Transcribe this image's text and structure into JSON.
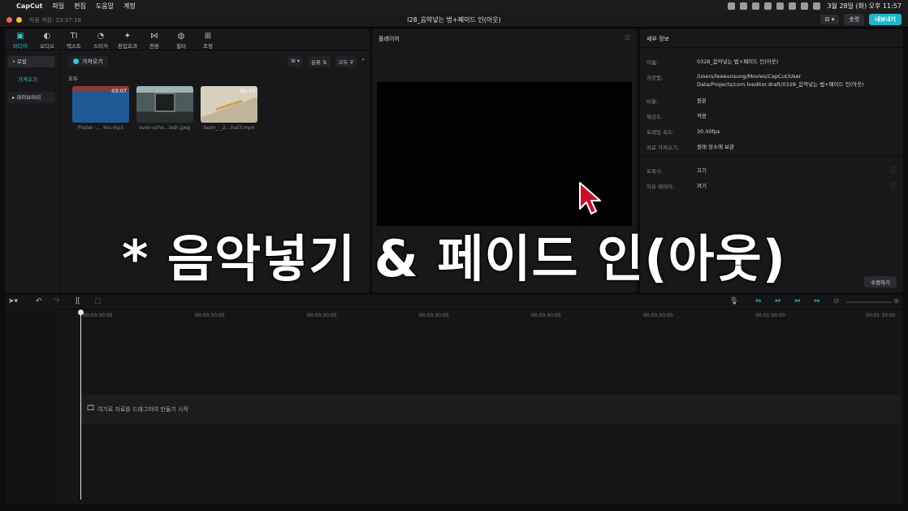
{
  "menubar": {
    "apple": "",
    "app_name": "CapCut",
    "items": [
      "파일",
      "편집",
      "도움말",
      "계정"
    ],
    "clock": "3월 28일 (화) 오후 11:57"
  },
  "titlebar": {
    "autosave": "자동 저장: 23:57:18",
    "title": "l28_음악넣는 법+페이드 인(아웃)",
    "shortcut_label": "숏컷",
    "export_label": "내보내기"
  },
  "toolbar": {
    "tools": [
      "미디어",
      "오디오",
      "텍스트",
      "스티커",
      "편집효과",
      "전환",
      "필터",
      "조정"
    ],
    "icons": [
      "▣",
      "◐",
      "TI",
      "◔",
      "✦",
      "⋈",
      "◍",
      "⊞"
    ]
  },
  "sidebar": {
    "items": [
      "• 로컬",
      "가져오기",
      "▸ 라이브러리"
    ]
  },
  "media": {
    "import_label": "가져오기",
    "sort_label": "분류",
    "all_filter_label": "모두",
    "all_label": "모두",
    "items": [
      {
        "name": "Poster -... You.mp3",
        "duration": "03:07"
      },
      {
        "name": "sven-sche...lash.jpeg",
        "duration": ""
      },
      {
        "name": "leam_-_2...inal3.mp4",
        "duration": "00:15"
      }
    ]
  },
  "player": {
    "title": "플레이어"
  },
  "details": {
    "title": "세부 정보",
    "rows": [
      {
        "label": "이름:",
        "value": "0328_음악넣는 법+페이드 인(아웃)"
      },
      {
        "label": "저장됨:",
        "value": "/Users/leeeunsung/Movies/CapCut/User Data/Projects/com.lveditor.draft/0328_음악넣는 법+페이드 인(아웃)"
      },
      {
        "label": "비율:",
        "value": "원본"
      },
      {
        "label": "해상도:",
        "value": "적용"
      },
      {
        "label": "프레임 속도:",
        "value": "30.00fps"
      },
      {
        "label": "자료 가져오기:",
        "value": "원래 장소에 보관"
      },
      {
        "label": "프록시:",
        "value": "끄기"
      },
      {
        "label": "자유 레이어:",
        "value": "켜기"
      }
    ],
    "edit_label": "수정하기"
  },
  "overlay": {
    "text": "* 음악넣기 & 페이드 인(아웃)"
  },
  "timeline": {
    "ticks": [
      "00:00:00:00",
      "00:00:10:00",
      "00:00:20:00",
      "00:00:30:00",
      "00:00:40:00",
      "00:00:50:00",
      "00:01:00:00",
      "00:01:10:00"
    ],
    "drop_hint": "여기로 자료를 드래그하여 만들기 시작"
  },
  "colors": {
    "accent": "#2fc7d8",
    "export": "#1fb7c9",
    "close": "#ff5f57",
    "minimize": "#febc2e"
  }
}
